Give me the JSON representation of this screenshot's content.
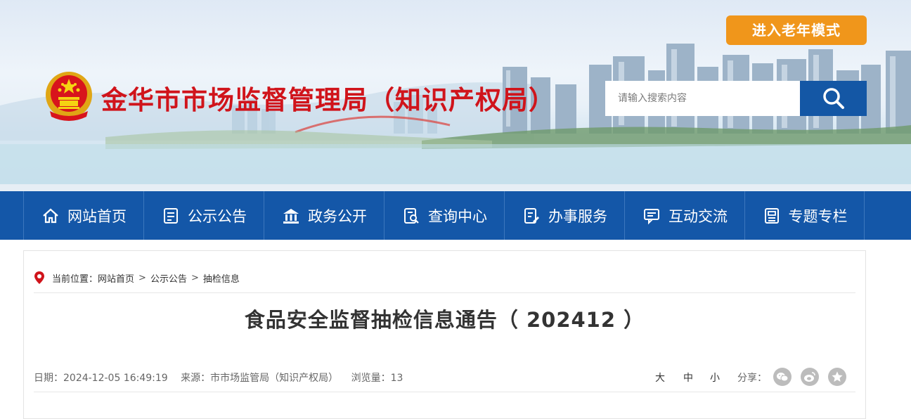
{
  "header": {
    "site_title": "金华市市场监督管理局（知识产权局）",
    "elder_mode_label": "进入老年模式",
    "search_placeholder": "请输入搜索内容"
  },
  "nav": {
    "items": [
      {
        "label": "网站首页",
        "icon": "home-icon"
      },
      {
        "label": "公示公告",
        "icon": "notice-icon"
      },
      {
        "label": "政务公开",
        "icon": "government-icon"
      },
      {
        "label": "查询中心",
        "icon": "query-icon"
      },
      {
        "label": "办事服务",
        "icon": "service-icon"
      },
      {
        "label": "互动交流",
        "icon": "chat-icon"
      },
      {
        "label": "专题专栏",
        "icon": "topic-icon"
      }
    ]
  },
  "breadcrumb": {
    "prefix": "当前位置：",
    "items": [
      "网站首页",
      "公示公告",
      "抽检信息"
    ],
    "separator": ">"
  },
  "article": {
    "title": "食品安全监督抽检信息通告（ 202412 ）",
    "date": "日期：2024-12-05 16:49:19",
    "source": "来源：市市场监管局（知识产权局）",
    "views": "浏览量：13"
  },
  "font_size": {
    "large": "大",
    "medium": "中",
    "small": "小"
  },
  "share": {
    "label": "分享：",
    "icons": [
      "wechat-icon",
      "weibo-icon",
      "favorite-icon"
    ]
  },
  "colors": {
    "title_red": "#d0141b",
    "nav_blue": "#1457a8",
    "elder_orange": "#f0961b",
    "search_blue": "#1457a5"
  }
}
